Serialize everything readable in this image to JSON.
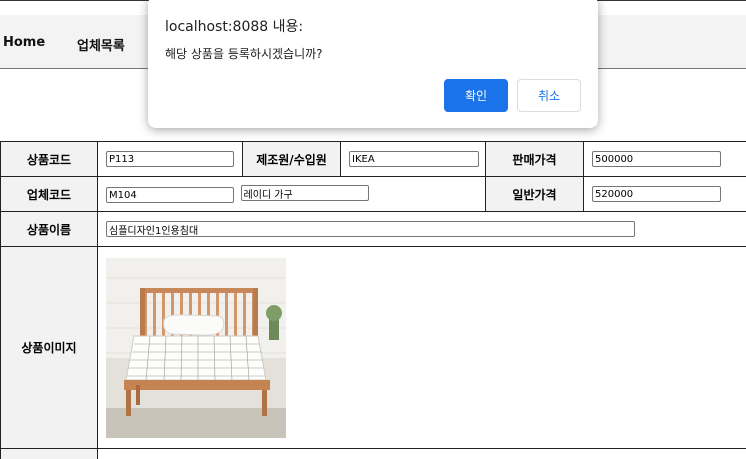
{
  "nav": {
    "home": "Home",
    "vendor_list": "업체목록"
  },
  "form": {
    "labels": {
      "product_code": "상품코드",
      "manufacturer": "제조원/수입원",
      "sale_price": "판매가격",
      "vendor_code": "업체코드",
      "regular_price": "일반가격",
      "product_name": "상품이름",
      "product_image": "상품이미지"
    },
    "values": {
      "product_code": "P113",
      "manufacturer": "IKEA",
      "sale_price": "500000",
      "vendor_code": "M104",
      "vendor_name": "레이디 가구",
      "regular_price": "520000",
      "product_name": "심플디자인1인용침대"
    }
  },
  "dialog": {
    "title": "localhost:8088 내용:",
    "message": "해당 상품을 등록하시겠습니까?",
    "ok_label": "확인",
    "cancel_label": "취소",
    "ok_color": "#1a73e8"
  }
}
